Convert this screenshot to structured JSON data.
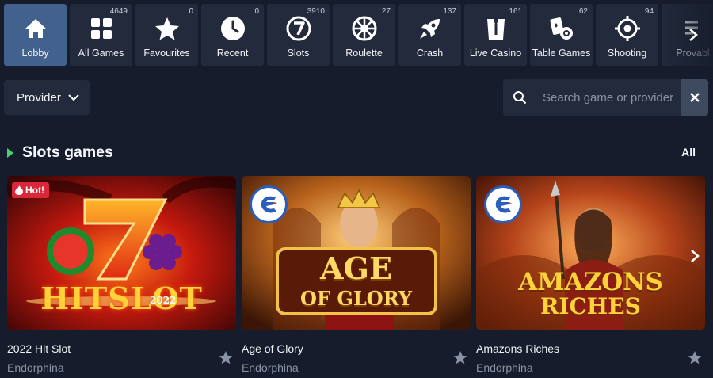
{
  "categories": [
    {
      "label": "Lobby",
      "count": "",
      "icon": "home-icon",
      "active": true
    },
    {
      "label": "All Games",
      "count": "4649",
      "icon": "grid-icon"
    },
    {
      "label": "Favourites",
      "count": "0",
      "icon": "star-icon"
    },
    {
      "label": "Recent",
      "count": "0",
      "icon": "clock-icon"
    },
    {
      "label": "Slots",
      "count": "3910",
      "icon": "slot-seven-icon"
    },
    {
      "label": "Roulette",
      "count": "27",
      "icon": "roulette-icon"
    },
    {
      "label": "Crash",
      "count": "137",
      "icon": "rocket-icon"
    },
    {
      "label": "Live Casino",
      "count": "161",
      "icon": "dealer-icon"
    },
    {
      "label": "Table Games",
      "count": "62",
      "icon": "cards-chip-icon"
    },
    {
      "label": "Shooting",
      "count": "94",
      "icon": "crosshair-icon"
    },
    {
      "label": "Provabl",
      "count": "",
      "icon": "provably-fair-icon"
    }
  ],
  "filters": {
    "provider_label": "Provider",
    "search_placeholder": "Search game or provider",
    "search_value": ""
  },
  "section": {
    "title": "Slots games",
    "all_label": "All"
  },
  "games": [
    {
      "name": "2022 Hit Slot",
      "provider": "Endorphina",
      "badge": "Hot!",
      "art_title": "HITSLOT",
      "art_sub": "2022"
    },
    {
      "name": "Age of Glory",
      "provider": "Endorphina",
      "art_title": "AGE",
      "art_sub": "OF GLORY"
    },
    {
      "name": "Amazons Riches",
      "provider": "Endorphina",
      "art_title": "AMAZONS",
      "art_sub": "RICHES"
    }
  ],
  "colors": {
    "background": "#161c2b",
    "tile": "#222a3b",
    "active_tile": "#42618c",
    "accent_green": "#43d36a",
    "hot_badge": "#d8283a"
  }
}
